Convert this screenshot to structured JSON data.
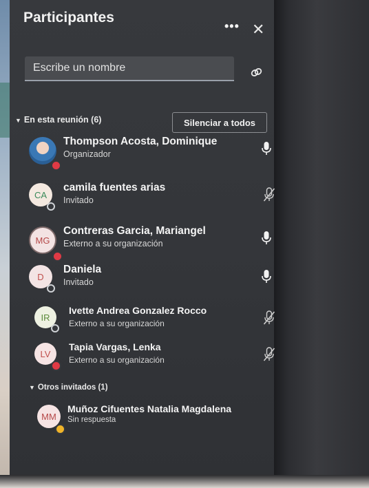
{
  "panel": {
    "title": "Participantes",
    "more_label": "•••",
    "close_label": "✕"
  },
  "search": {
    "placeholder": "Escribe un nombre"
  },
  "meeting_section": {
    "label": "En esta reunión (6)",
    "mute_all_label": "Silenciar a todos"
  },
  "participants": [
    {
      "name": "Thompson Acosta, Dominique",
      "role": "Organizador",
      "initials": "",
      "status": "busy",
      "mic": "on"
    },
    {
      "name": "camila fuentes arias",
      "role": "Invitado",
      "initials": "CA",
      "status": "offline",
      "mic": "muted"
    },
    {
      "name": "Contreras Garcia, Mariangel",
      "role": "Externo a su organización",
      "initials": "MG",
      "status": "busy",
      "mic": "on"
    },
    {
      "name": "Daniela",
      "role": "Invitado",
      "initials": "D",
      "status": "offline",
      "mic": "on"
    },
    {
      "name": "Ivette Andrea Gonzalez Rocco",
      "role": "Externo a su organización",
      "initials": "IR",
      "status": "offline",
      "mic": "muted"
    },
    {
      "name": "Tapia Vargas, Lenka",
      "role": "Externo a su organización",
      "initials": "LV",
      "status": "busy",
      "mic": "muted"
    }
  ],
  "others_section": {
    "label": "Otros invitados (1)"
  },
  "invitees": [
    {
      "name": "Muñoz Cifuentes Natalia Magdalena",
      "role": "Sin respuesta",
      "initials": "MM",
      "status": "away"
    }
  ],
  "colors": {
    "panel_bg": "#36383c",
    "busy": "#e03a45",
    "away": "#f0b429",
    "offline_ring": "#cfd2d6"
  }
}
